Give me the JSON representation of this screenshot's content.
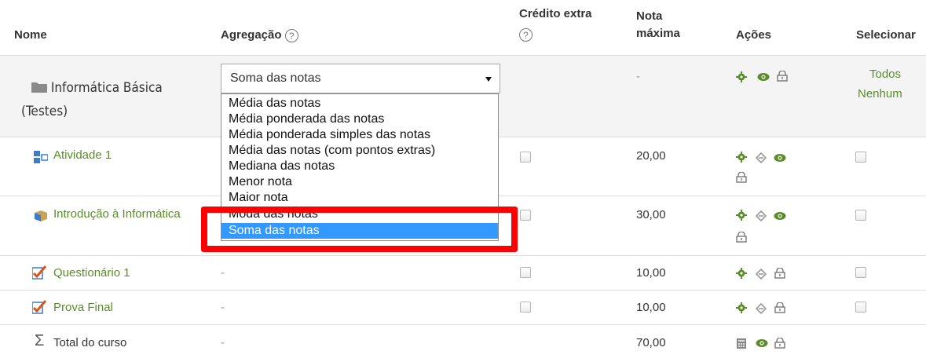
{
  "headers": {
    "name": "Nome",
    "aggregation": "Agregação",
    "extra_credit": "Crédito extra",
    "max_grade_line1": "Nota",
    "max_grade_line2": "máxima",
    "actions": "Ações",
    "select": "Selecionar"
  },
  "category": {
    "name_line1": "Informática Básica",
    "name_line2": "(Testes)",
    "max_grade": "-",
    "select_all": "Todos",
    "select_none": "Nenhum",
    "icons": [
      "gear-icon",
      "eye-icon",
      "lock-icon"
    ]
  },
  "aggregation_select": {
    "value": "Soma das notas",
    "options": [
      "Média das notas",
      "Média ponderada das notas",
      "Média ponderada simples das notas",
      "Média das notas (com pontos extras)",
      "Mediana das notas",
      "Menor nota",
      "Maior nota",
      "Moda das notas",
      "Soma das notas"
    ],
    "highlighted_option": "Soma das notas"
  },
  "items": [
    {
      "name": "Atividade 1",
      "aggregation": "",
      "max_grade": "20,00",
      "icon": "assignment-icon",
      "actions": [
        "gear-icon",
        "move-icon",
        "eye-icon",
        "lock-icon"
      ]
    },
    {
      "name": "Introdução à Informática",
      "aggregation": "",
      "max_grade": "30,00",
      "icon": "lesson-icon",
      "actions": [
        "gear-icon",
        "move-icon",
        "eye-icon",
        "lock-icon"
      ]
    },
    {
      "name": "Questionário 1",
      "aggregation": "-",
      "max_grade": "10,00",
      "icon": "quiz-icon",
      "actions": [
        "gear-icon",
        "move-icon",
        "lock-icon"
      ]
    },
    {
      "name": "Prova Final",
      "aggregation": "-",
      "max_grade": "10,00",
      "icon": "quiz-icon",
      "actions": [
        "gear-icon",
        "move-icon",
        "lock-icon"
      ]
    }
  ],
  "total": {
    "name": "Total do curso",
    "aggregation": "-",
    "max_grade": "70,00",
    "icons": [
      "calculator-icon",
      "eye-icon",
      "lock-icon"
    ]
  },
  "colors": {
    "link": "#5a8c2a",
    "selected_option": "#3399ff",
    "highlight_box": "#ff0000"
  }
}
